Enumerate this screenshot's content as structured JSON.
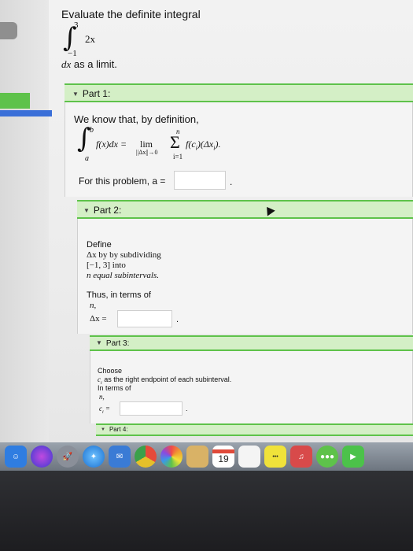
{
  "problem": {
    "title": "Evaluate the definite integral",
    "upper_limit": "3",
    "lower_limit": "−1",
    "integrand": "2x",
    "differential": "dx",
    "tail": "as a limit."
  },
  "part1": {
    "header": "Part 1:",
    "intro": "We know that, by definition,",
    "int_upper": "b",
    "int_lower": "a",
    "lhs": "f(x)dx =",
    "lim": "lim",
    "lim_sub": "||Δx||→0",
    "sum_top": "n",
    "sum_bottom": "i=1",
    "sum_term": "f(c",
    "sum_term_sub": "i",
    "sum_term_end": ")(Δx",
    "sum_term_end_sub": "i",
    "sum_close": ").",
    "prompt": "For this problem, a =",
    "a_value": "",
    "period": "."
  },
  "part2": {
    "header": "Part 2:",
    "line1": "Define",
    "line2": "Δx by by subdividing",
    "line3": "[−1, 3] into",
    "line4": "n equal subintervals.",
    "line5": "Thus, in terms of",
    "line6": "n,",
    "prompt": "Δx =",
    "value": "",
    "period": "."
  },
  "part3": {
    "header": "Part 3:",
    "line1": "Choose",
    "line2": "c",
    "line2_sub": "i",
    "line2_rest": "as the right endpoint of each subinterval.",
    "line3": "In terms of",
    "line4": "n,",
    "prompt": "c",
    "prompt_sub": "i",
    "prompt_eq": "=",
    "value": "",
    "period": "."
  },
  "part4": {
    "header": "Part 4:"
  },
  "dock": {
    "calendar_day": "19",
    "icons": [
      "finder-icon",
      "siri-icon",
      "launchpad-icon",
      "safari-icon",
      "mail-icon",
      "chrome-icon",
      "photos-icon",
      "notes-icon",
      "calendar-icon",
      "reminders-icon",
      "music-icon",
      "photobooth-icon",
      "messages-icon",
      "facetime-icon"
    ],
    "colors": {
      "finder": "#2f7de1",
      "siri": "#6a4bd6",
      "launchpad": "#8a8f99",
      "safari": "#2c8fe6",
      "mail": "#3a7bd5",
      "chrome": "#e6c02a",
      "photos": "#f0a030",
      "notes": "#d9b266",
      "calendar": "#ffffff",
      "reminders": "#f4f4f4",
      "music": "#f0e23a",
      "photobooth": "#d84a4a",
      "messages": "#5ec24a",
      "facetime": "#4cc24a"
    }
  }
}
